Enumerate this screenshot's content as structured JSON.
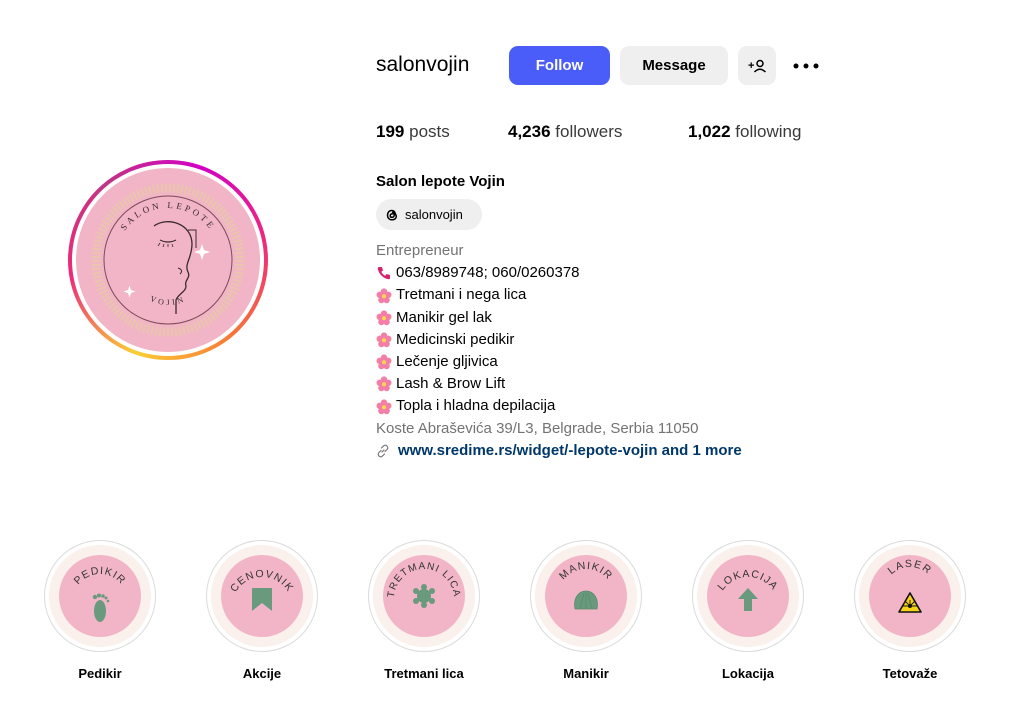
{
  "profile": {
    "username": "salonvojin",
    "avatar_text": {
      "top": "SALON LEPOTE",
      "bottom": "VOJIN"
    },
    "full_name": "Salon lepote Vojin",
    "threads_handle": "salonvojin"
  },
  "actions": {
    "follow_label": "Follow",
    "message_label": "Message",
    "add_user_label": "+⎕",
    "more_label": "•••"
  },
  "stats": {
    "posts_count": "199",
    "posts_label": "posts",
    "followers_count": "4,236",
    "followers_label": "followers",
    "following_count": "1,022",
    "following_label": "following"
  },
  "bio": {
    "category": "Entrepreneur",
    "phone": "063/8989748; 060/0260378",
    "services": [
      "Tretmani i nega lica",
      "Manikir gel lak",
      "Medicinski pedikir",
      "Lečenje gljivica",
      "Lash & Brow Lift",
      "Topla i hladna depilacija"
    ],
    "address": "Koste Abraševića 39/L3, Belgrade, Serbia 11050",
    "link": "www.sredime.rs/widget/-lepote-vojin and 1 more"
  },
  "highlights": [
    {
      "label": "Pedikir",
      "cover_text": "PEDIKIR",
      "icon": "foot-icon"
    },
    {
      "label": "Akcije",
      "cover_text": "CENOVNIK",
      "icon": "bookmark-icon"
    },
    {
      "label": "Tretmani lica",
      "cover_text": "TRETMANI LICA",
      "icon": "flower-icon"
    },
    {
      "label": "Manikir",
      "cover_text": "MANIKIR",
      "icon": "shell-icon"
    },
    {
      "label": "Lokacija",
      "cover_text": "LOKACIJA",
      "icon": "arrow-up-icon"
    },
    {
      "label": "Tetovaže",
      "cover_text": "LASER",
      "icon": "laser-warning-icon"
    }
  ],
  "colors": {
    "follow_button": "#4a5df9",
    "link": "#00376b",
    "highlight_pink": "#f2b5c7",
    "highlight_icon": "#6a9a7e"
  }
}
